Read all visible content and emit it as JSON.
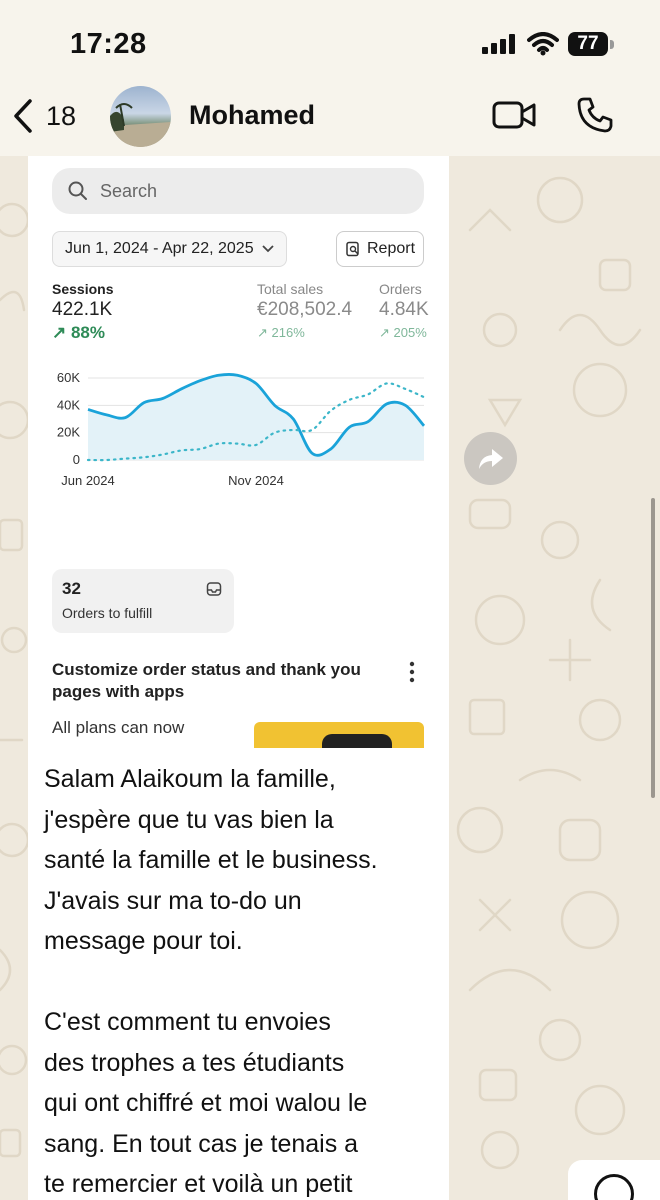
{
  "status_bar": {
    "time": "17:28",
    "battery": "77"
  },
  "header": {
    "back_count": "18",
    "contact_name": "Mohamed"
  },
  "screenshot": {
    "search_placeholder": "Search",
    "date_range": "Jun 1, 2024 - Apr 22, 2025",
    "report_label": "Report",
    "metrics": [
      {
        "label": "Sessions",
        "value": "422.1K",
        "change": "88%"
      },
      {
        "label": "Total sales",
        "value": "€208,502.4",
        "change": "216%"
      },
      {
        "label": "Orders",
        "value": "4.84K",
        "change": "205%"
      }
    ],
    "fulfill": {
      "count": "32",
      "label": "Orders to fulfill"
    },
    "card": {
      "title": "Customize order status and thank you pages with apps",
      "body": "All plans can now"
    }
  },
  "chart_data": {
    "type": "line",
    "y_ticks": [
      "60K",
      "40K",
      "20K",
      "0"
    ],
    "x_ticks": [
      "Jun 2024",
      "Nov 2024"
    ],
    "ylim": [
      0,
      60000
    ],
    "series": [
      {
        "style": "solid",
        "color": "#1aa3d9",
        "values": [
          37000,
          33000,
          31000,
          42000,
          45000,
          52000,
          58000,
          62000,
          62000,
          56000,
          40000,
          30000,
          5000,
          8000,
          24000,
          28000,
          41000,
          40000,
          25000
        ]
      },
      {
        "style": "dotted",
        "color": "#3cb6c9",
        "values": [
          0,
          0,
          1000,
          2000,
          4000,
          7000,
          8000,
          12000,
          12000,
          11000,
          20000,
          22000,
          22000,
          36000,
          44000,
          48000,
          56000,
          52000,
          46000
        ]
      }
    ]
  },
  "message": {
    "text": "Salam Alaikoum la famille,\nj'espère que tu vas bien la\nsanté la famille et le business.\nJ'avais sur ma to-do un\nmessage pour toi.\n\nC'est comment tu envoies\ndes trophes a tes étudiants\nqui ont chiffré et moi walou le\nsang. En tout cas je tenais a\nte remercier et voilà un petit"
  },
  "colors": {
    "accent_green": "#2e8b57",
    "wallpaper": "#efe9dd",
    "line_blue": "#1aa3d9"
  },
  "icons": {
    "back": "chevron-left-icon",
    "video": "video-camera-icon",
    "phone": "phone-icon",
    "forward": "forward-icon",
    "scroll_down": "chevron-down-circle-icon"
  }
}
